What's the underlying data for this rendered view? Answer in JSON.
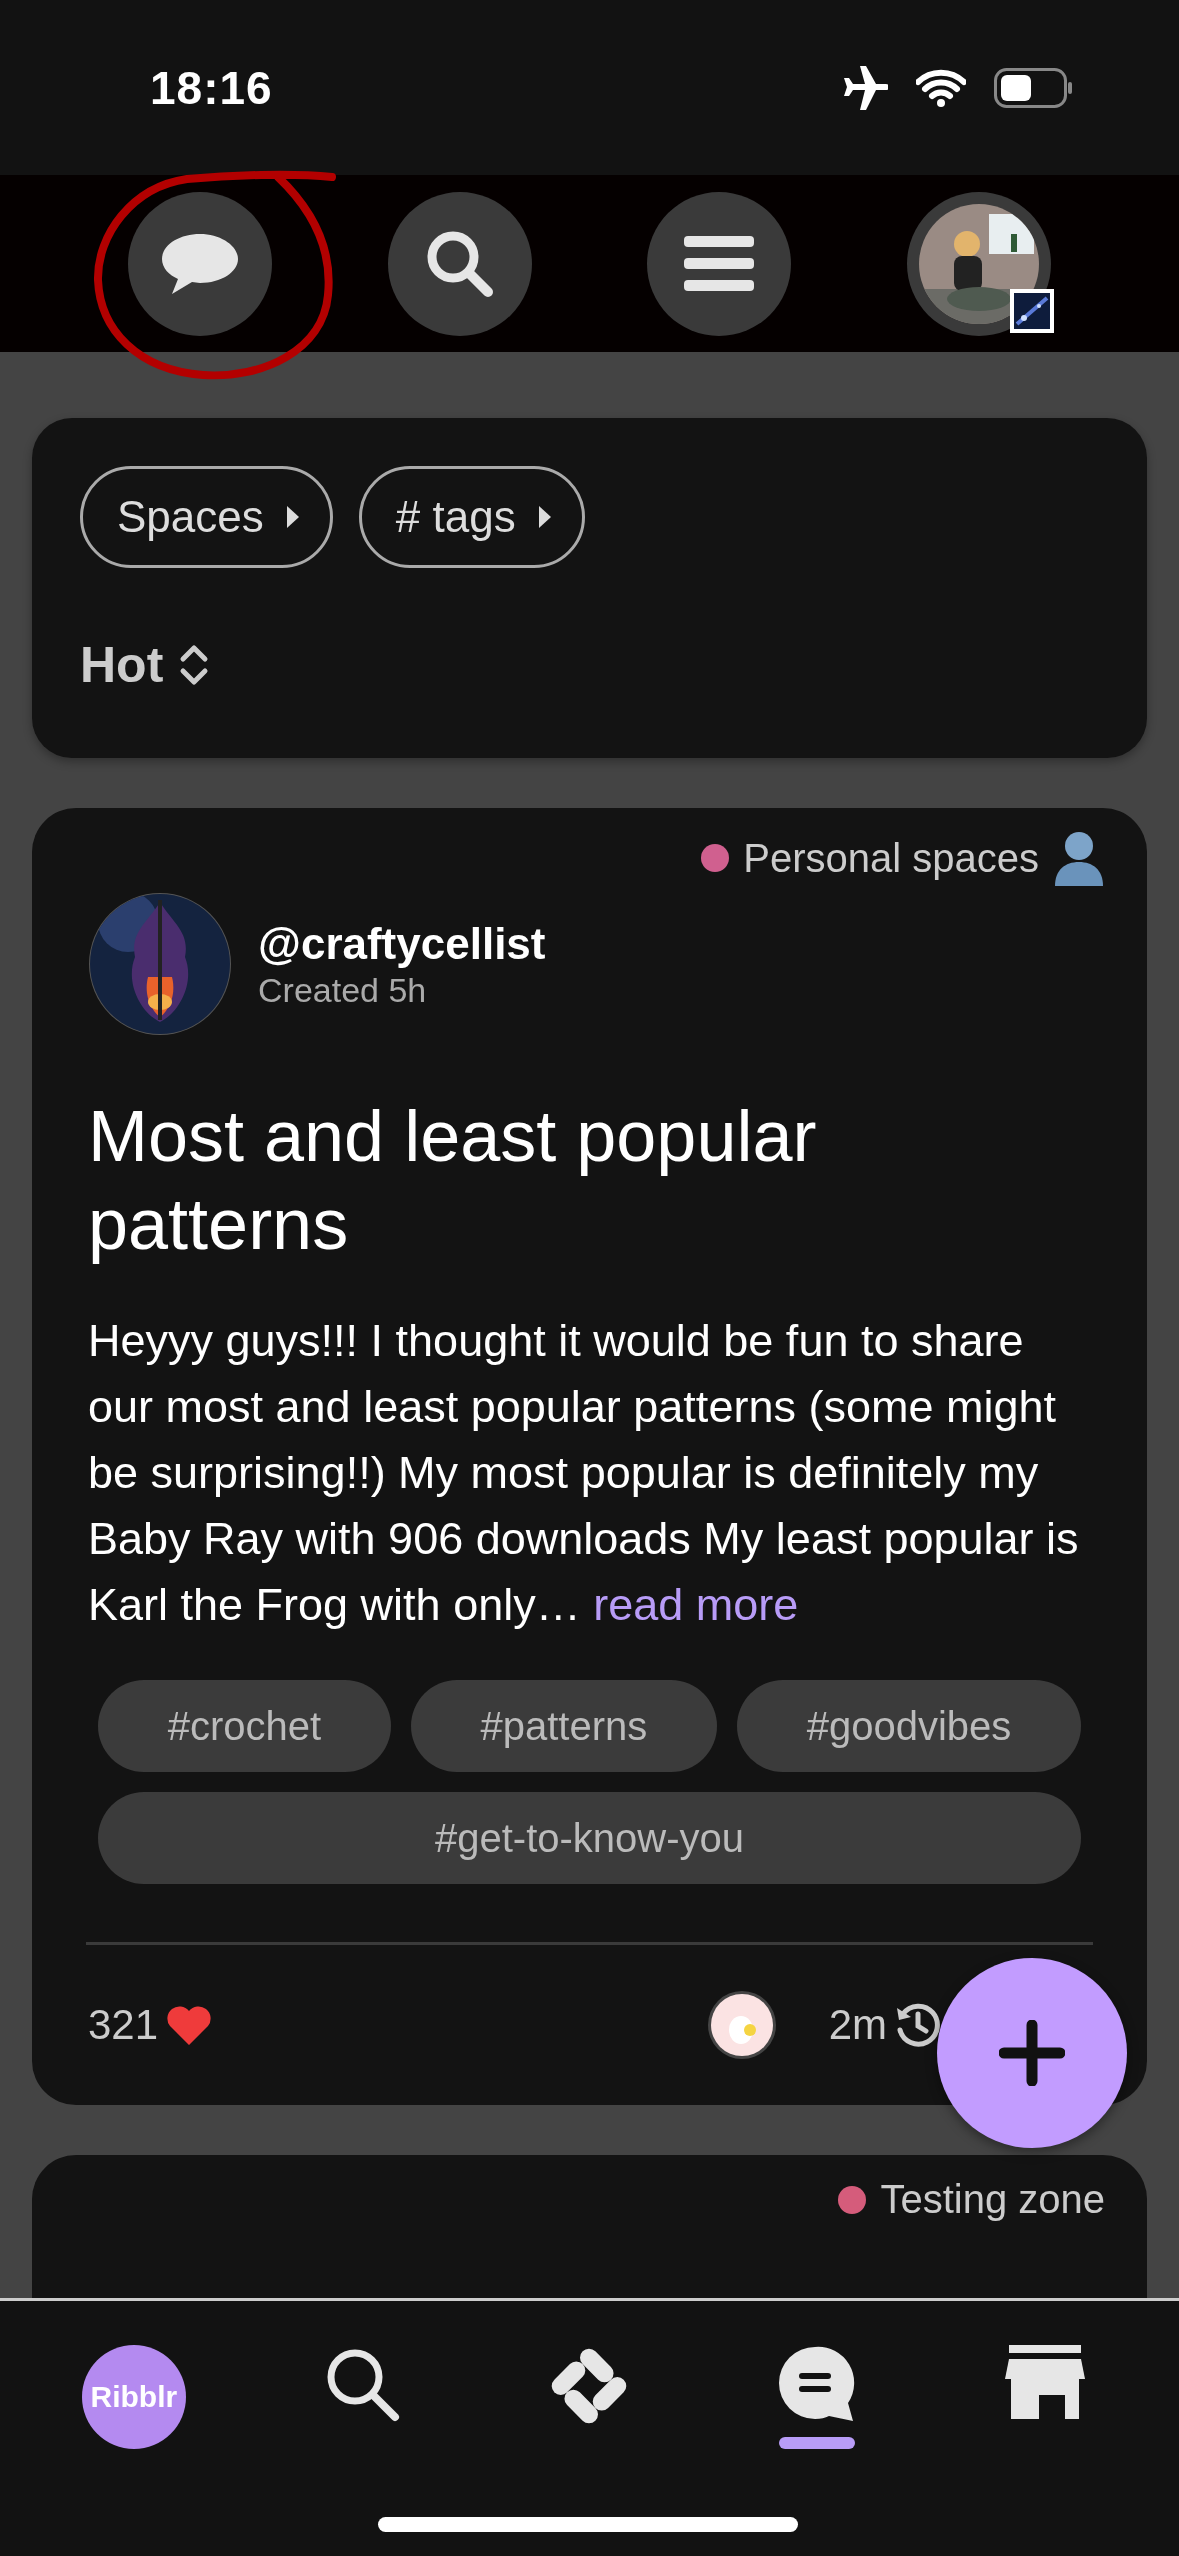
{
  "status_bar": {
    "time": "18:16"
  },
  "top_nav": [
    {
      "kind": "chat"
    },
    {
      "kind": "search"
    },
    {
      "kind": "menu"
    },
    {
      "kind": "avatar"
    }
  ],
  "filters": {
    "chips": [
      "Spaces",
      "# tags"
    ],
    "sort": "Hot"
  },
  "posts": [
    {
      "space": "Personal spaces",
      "color": "#d0608f",
      "author": "@craftycellist",
      "created": "Created 5h",
      "title": "Most and least popular patterns",
      "body": "Heyyy guys!!! I thought it would be fun to share our most and least popular patterns (some might be surprising!!) My most popular is definitely my Baby Ray with 906 downloads My least popular is Karl the Frog with only…",
      "read_more": "read more",
      "tags": [
        "#crochet",
        "#patterns",
        "#goodvibes",
        "#get-to-know-you"
      ],
      "likes": "321",
      "last_activity": "2m"
    },
    {
      "space": "Testing zone",
      "color": "#d55c7b"
    }
  ],
  "bottom_nav": [
    {
      "kind": "logo",
      "label": "Ribblr",
      "selected": false
    },
    {
      "kind": "search",
      "selected": false
    },
    {
      "kind": "patterns",
      "selected": false
    },
    {
      "kind": "chat",
      "selected": true
    },
    {
      "kind": "shop",
      "selected": false
    }
  ]
}
